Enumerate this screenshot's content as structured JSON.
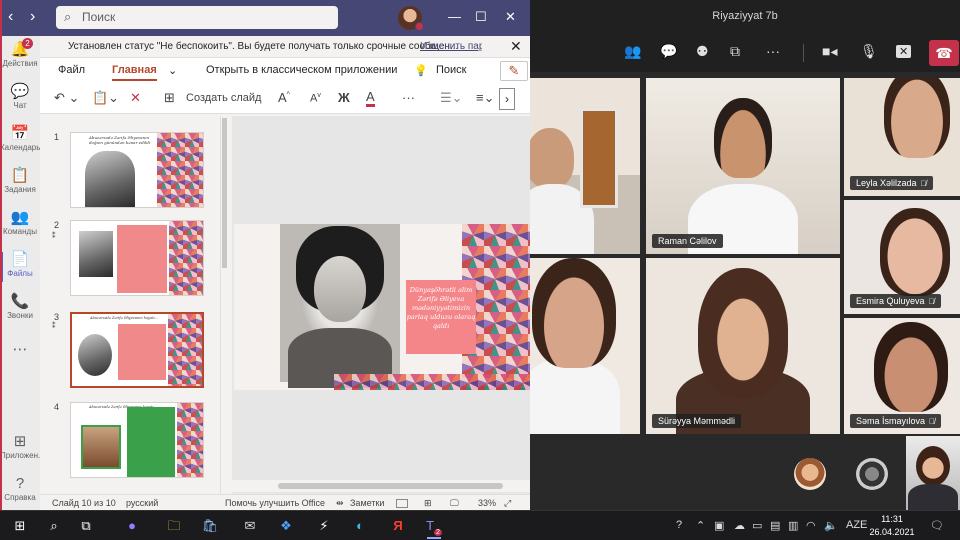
{
  "teams_window": {
    "search_placeholder": "Поиск",
    "notice": {
      "text": "Установлен статус \"Не беспокоить\". Вы будете получать только срочные сообщен...",
      "link": "Изменить пар"
    },
    "rail": [
      {
        "icon": "bell-icon",
        "glyph": "🔔",
        "label": "Действия",
        "badge": "2"
      },
      {
        "icon": "chat-icon",
        "glyph": "💬",
        "label": "Чат"
      },
      {
        "icon": "calendar-icon",
        "glyph": "📅",
        "label": "Календарь"
      },
      {
        "icon": "assignments-icon",
        "glyph": "📋",
        "label": "Задания"
      },
      {
        "icon": "teams-icon",
        "glyph": "👥",
        "label": "Команды"
      },
      {
        "icon": "files-icon",
        "glyph": "📄",
        "label": "Файлы"
      },
      {
        "icon": "calls-icon",
        "glyph": "📞",
        "label": "Звонки"
      },
      {
        "icon": "more-icon",
        "glyph": "⋯",
        "label": ""
      },
      {
        "icon": "apps-icon",
        "glyph": "⊞",
        "label": "Приложен..."
      },
      {
        "icon": "help-icon",
        "glyph": "?",
        "label": "Справка"
      }
    ]
  },
  "powerpoint": {
    "tabs": {
      "file": "Файл",
      "home": "Главная",
      "open_desktop": "Открыть в классическом приложении",
      "search": "Поиск"
    },
    "tools": {
      "new_slide": "Создать слайд",
      "bold": "Ж"
    },
    "thumbnails": [
      {
        "number": "1",
        "title": "Abuzərzadə Zərifə Əliyevanın doğum günündən kənar edildi",
        "has_star": false
      },
      {
        "number": "2",
        "has_star": true
      },
      {
        "number": "3",
        "title": "Abuzərzadə Zərifə Əliyevanın həyatı...",
        "has_star": true
      },
      {
        "number": "4",
        "title": "Abuzərzadə Zərifə Əliyevanın həyatı...",
        "has_star": false
      }
    ],
    "slide_text": "Dünyaşöhrətli alim Zərifə Əliyeva mədəniyyətimizin parlaq ulduzu olaraq qaldı",
    "status": {
      "slide_info": "Слайд 10 из 10",
      "language": "русский",
      "feedback": "Помочь улучшить Office",
      "notes": "Заметки",
      "zoom": "33%"
    }
  },
  "meeting": {
    "title": "Riyaziyyat 7b",
    "participants": [
      {
        "name": "Raman Cəlilov",
        "muted": false
      },
      {
        "name": "Leyla Xəlilzada",
        "muted": true
      },
      {
        "name": "Esmira Quluyeva",
        "muted": true
      },
      {
        "name": "Sürəyya Məmmədli",
        "muted": false
      },
      {
        "name": "Səma İsmayılova",
        "muted": true
      }
    ]
  },
  "taskbar": {
    "teams_badge": "2",
    "language": "AZE",
    "time": "11:31",
    "date": "26.04.2021"
  },
  "colors": {
    "teams_purple": "#464775",
    "ppt_accent": "#b7472a",
    "hangup_red": "#c4314b"
  }
}
